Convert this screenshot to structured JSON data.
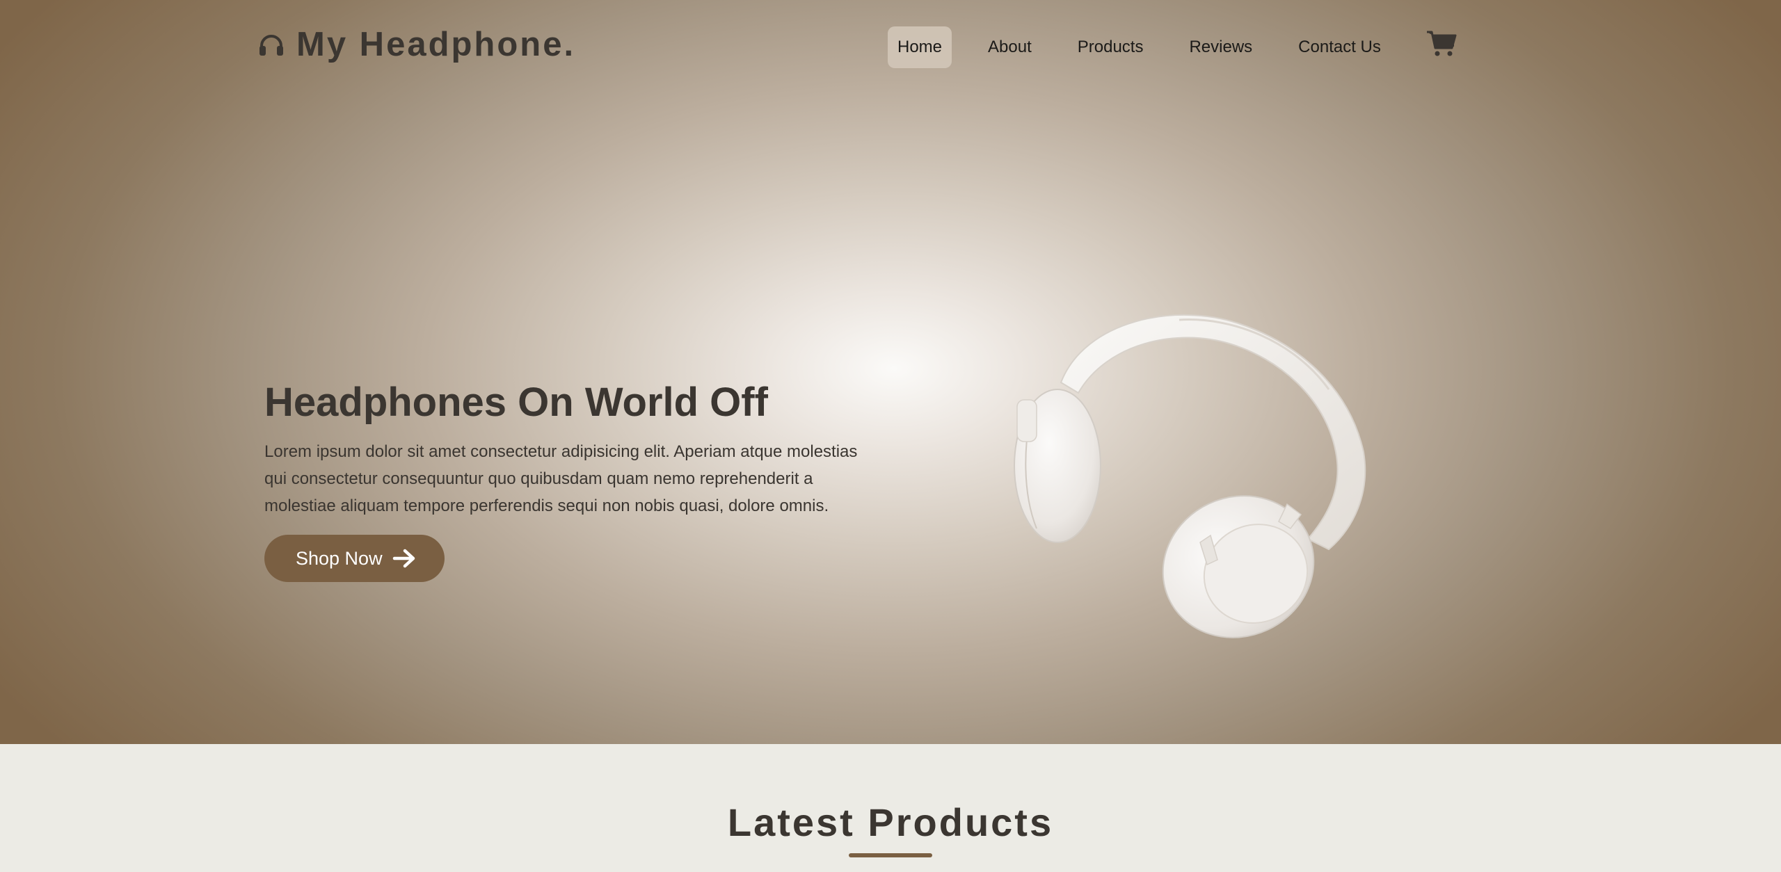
{
  "brand": {
    "name": "My Headphone.",
    "icon": "headphones-icon"
  },
  "nav": {
    "items": [
      {
        "label": "Home",
        "active": true
      },
      {
        "label": "About",
        "active": false
      },
      {
        "label": "Products",
        "active": false
      },
      {
        "label": "Reviews",
        "active": false
      },
      {
        "label": "Contact Us",
        "active": false
      }
    ],
    "cart_icon": "cart-icon"
  },
  "hero": {
    "title": "Headphones On World Off",
    "description": "Lorem ipsum dolor sit amet consectetur adipisicing elit. Aperiam atque molestias qui consectetur consequuntur quo quibusdam quam nemo reprehenderit a molestiae aliquam tempore perferendis sequi non nobis quasi, dolore omnis.",
    "button_label": "Shop Now",
    "button_icon": "arrow-right-icon",
    "image": "white-headphones-image"
  },
  "latest": {
    "title": "Latest Products"
  },
  "colors": {
    "accent": "#7a5f42",
    "text_dark": "#3b3631",
    "section_bg": "#ecebe5"
  }
}
